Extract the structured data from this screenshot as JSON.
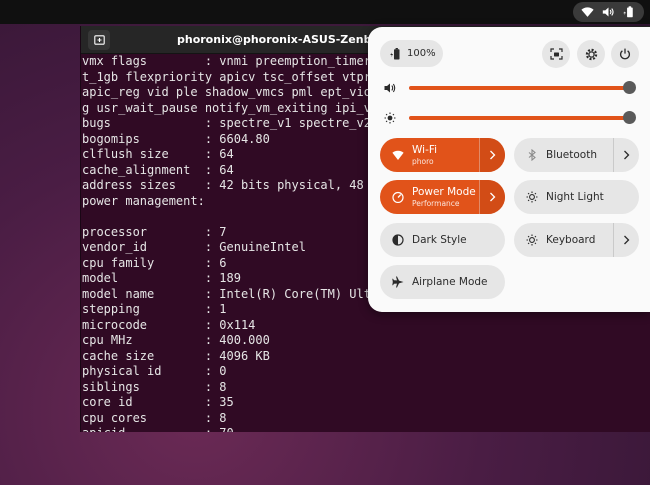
{
  "topbar": {
    "icons": [
      "wifi-icon",
      "volume-icon",
      "battery-icon"
    ]
  },
  "terminal": {
    "title": "phoronix@phoronix-ASUS-Zenbook-S-",
    "lines": [
      "vmx flags        : vnmi preemption_timer p",
      "t_1gb flexpriority apicv tsc_offset vtpr",
      "apic_reg vid ple shadow_vmcs pml ept_viol",
      "g usr_wait_pause notify_vm_exiting ipi_vi",
      "bugs             : spectre_v1 spectre_v2 s",
      "bogomips         : 6604.80",
      "clflush size     : 64",
      "cache_alignment  : 64",
      "address sizes    : 42 bits physical, 48 bi",
      "power management:",
      "",
      "processor        : 7",
      "vendor_id        : GenuineIntel",
      "cpu family       : 6",
      "model            : 189",
      "model name       : Intel(R) Core(TM) Ultra",
      "stepping         : 1",
      "microcode        : 0x114",
      "cpu MHz          : 400.000",
      "cache size       : 4096 KB",
      "physical id      : 0",
      "siblings         : 8",
      "core id          : 35",
      "cpu cores        : 8",
      "apicid           : 70"
    ]
  },
  "quick_settings": {
    "battery_label": "100%",
    "volume_level": 1.0,
    "brightness_level": 1.0,
    "accent_color": "#e1531a",
    "tiles": {
      "wifi": {
        "label": "Wi-Fi",
        "sub": "phoro",
        "active": true,
        "has_arrow": true
      },
      "bluetooth": {
        "label": "Bluetooth",
        "active": false,
        "has_arrow": true
      },
      "power_mode": {
        "label": "Power Mode",
        "sub": "Performance",
        "active": true,
        "has_arrow": true
      },
      "night_light": {
        "label": "Night Light",
        "active": false,
        "has_arrow": false
      },
      "dark_style": {
        "label": "Dark Style",
        "active": false,
        "has_arrow": false
      },
      "keyboard": {
        "label": "Keyboard",
        "active": false,
        "has_arrow": true
      },
      "airplane_mode": {
        "label": "Airplane Mode",
        "active": false,
        "has_arrow": false
      }
    }
  }
}
